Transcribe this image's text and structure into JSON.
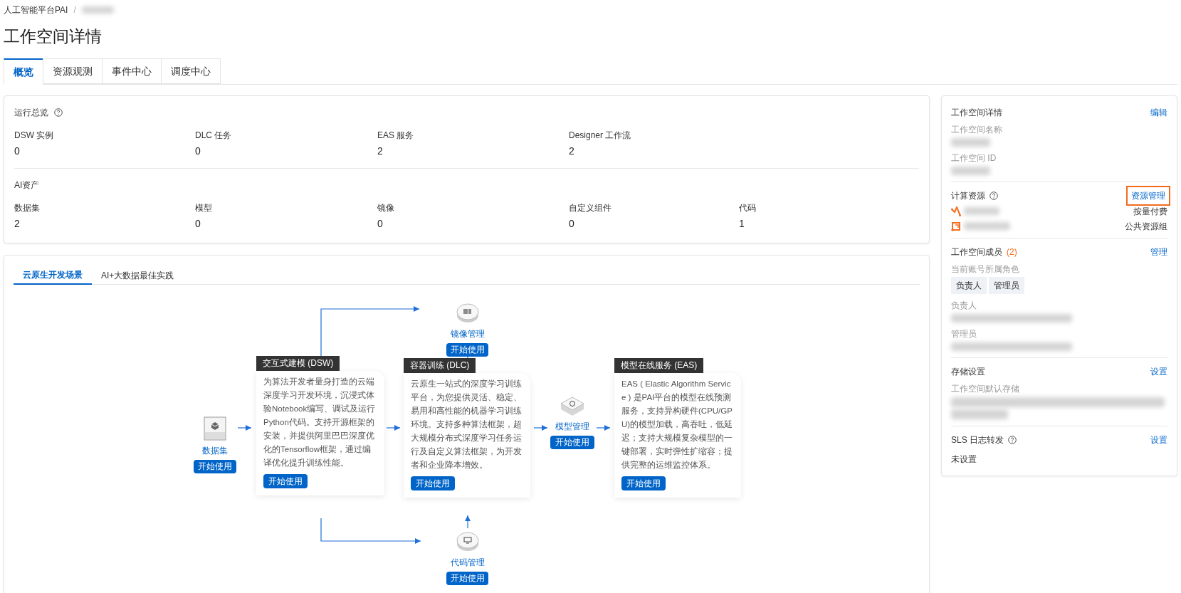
{
  "breadcrumb": {
    "items": [
      "人工智能平台PAI"
    ],
    "separator": "/"
  },
  "page_title": "工作空间详情",
  "tabs": [
    {
      "label": "概览",
      "selected": true
    },
    {
      "label": "资源观测",
      "selected": false
    },
    {
      "label": "事件中心",
      "selected": false
    },
    {
      "label": "调度中心",
      "selected": false
    }
  ],
  "overview": {
    "title": "运行总览",
    "help": true,
    "stats": [
      {
        "label": "DSW 实例",
        "value": "0"
      },
      {
        "label": "DLC 任务",
        "value": "0"
      },
      {
        "label": "EAS 服务",
        "value": "2"
      },
      {
        "label": "Designer 工作流",
        "value": "2"
      }
    ]
  },
  "assets": {
    "title": "AI资产",
    "help": false,
    "stats": [
      {
        "label": "数据集",
        "value": "2"
      },
      {
        "label": "模型",
        "value": "0"
      },
      {
        "label": "镜像",
        "value": "0"
      },
      {
        "label": "自定义组件",
        "value": "0"
      },
      {
        "label": "代码",
        "value": "1"
      }
    ]
  },
  "scenario_tabs": [
    {
      "label": "云原生开发场景",
      "selected": true
    },
    {
      "label": "AI+大数据最佳实践",
      "selected": false
    }
  ],
  "diagram": {
    "nodes": [
      {
        "kind": "dataset",
        "label": "数据集",
        "button": "开始使用"
      },
      {
        "kind": "image",
        "label": "镜像管理",
        "button": "开始使用"
      },
      {
        "kind": "code",
        "label": "代码管理",
        "button": "开始使用"
      },
      {
        "kind": "model",
        "label": "模型管理",
        "button": "开始使用"
      }
    ],
    "cards": [
      {
        "title": "交互式建模 (DSW)",
        "description": "为算法开发者量身打造的云端深度学习开发环境，沉浸式体验Notebook编写、调试及运行Python代码。支持开源框架的安装，并提供阿里巴巴深度优化的Tensorflow框架，通过编译优化提升训练性能。",
        "button": "开始使用"
      },
      {
        "title": "容器训练 (DLC)",
        "description": "云原生一站式的深度学习训练平台，为您提供灵活、稳定、易用和高性能的机器学习训练环境。支持多种算法框架，超大规模分布式深度学习任务运行及自定义算法框架，为开发者和企业降本增效。",
        "button": "开始使用"
      },
      {
        "title": "模型在线服务 (EAS)",
        "description": "EAS ( Elastic Algorithm Service ) 是PAI平台的模型在线预测服务，支持异构硬件(CPU/GPU)的模型加载，高吞吐，低延迟；支持大规模复杂模型的一键部署，实时弹性扩缩容；提供完整的运维监控体系。",
        "button": "开始使用"
      }
    ]
  },
  "details_panel": {
    "sections": [
      {
        "kind": "fields",
        "title": "工作空间详情",
        "help": false,
        "action": "编辑",
        "highlighted": false,
        "fields": [
          "工作空间名称",
          "工作空间 ID"
        ]
      },
      {
        "kind": "resources",
        "title": "计算资源",
        "help": true,
        "action": "资源管理",
        "highlighted": true,
        "resources": [
          {
            "kind": "general",
            "note": "按量付费"
          },
          {
            "kind": "lingjun",
            "note": "公共资源组"
          }
        ]
      },
      {
        "kind": "members",
        "title": "工作空间成员",
        "count": "(2)",
        "help": false,
        "action": "管理",
        "highlighted": false,
        "role_label": "当前账号所属角色",
        "roles": [
          "负责人",
          "管理员"
        ],
        "fields": [
          "负责人",
          "管理员"
        ]
      },
      {
        "kind": "storage",
        "title": "存储设置",
        "help": false,
        "action": "设置",
        "highlighted": false,
        "fields": [
          "工作空间默认存储"
        ]
      },
      {
        "kind": "value",
        "title": "SLS 日志转发",
        "help": true,
        "action": "设置",
        "highlighted": false,
        "value": "未设置"
      }
    ]
  }
}
